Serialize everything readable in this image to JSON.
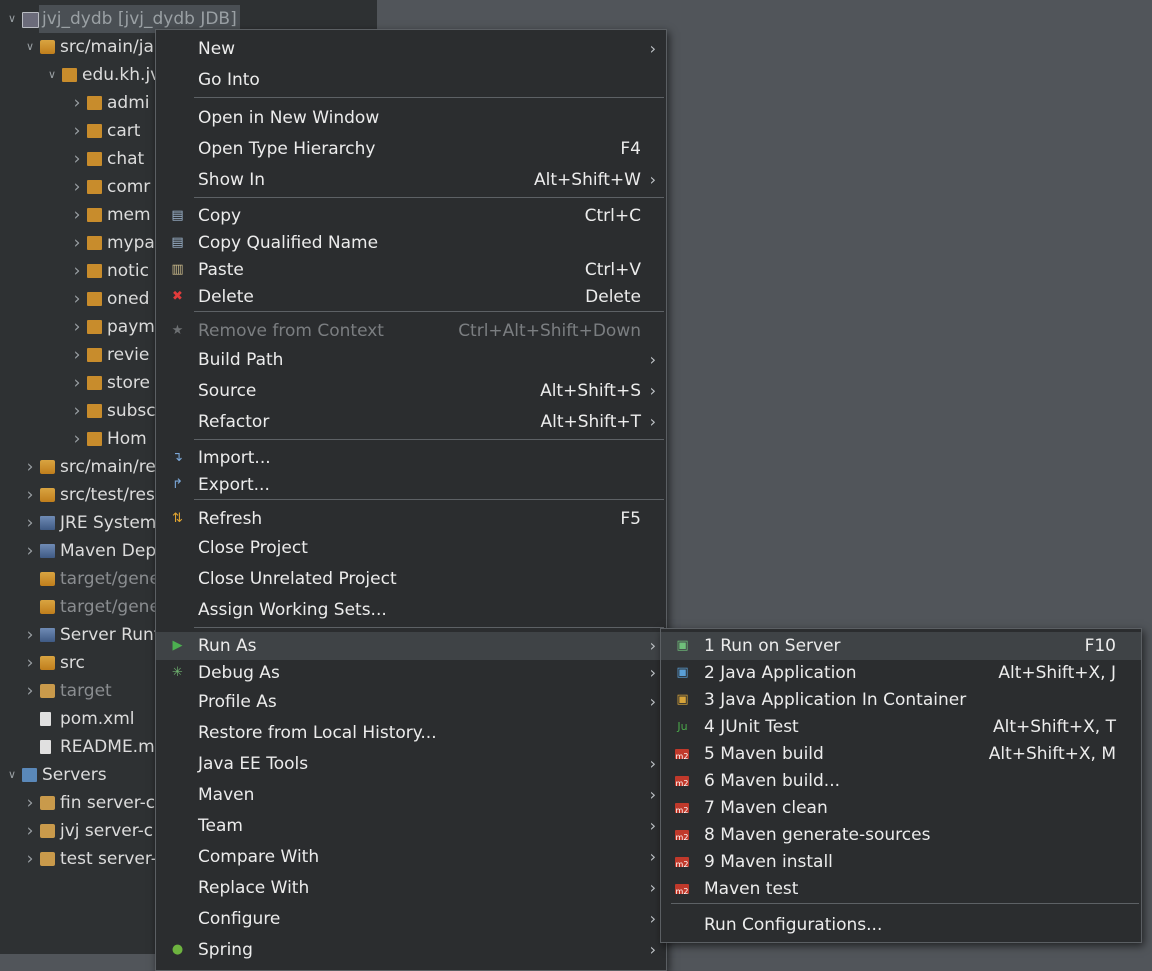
{
  "explorer": {
    "items": [
      {
        "label": "jvj_dydb [jvj_dydb JDB]",
        "indent": 0,
        "chev": "open",
        "icon": "project-icon",
        "selected": true
      },
      {
        "label": "src/main/ja",
        "indent": 1,
        "chev": "open",
        "icon": "package-folder-icon"
      },
      {
        "label": "edu.kh.jv",
        "indent": 2,
        "chev": "open",
        "icon": "package-icon"
      },
      {
        "label": "admi",
        "indent": 3,
        "chev": "closed",
        "icon": "package-icon"
      },
      {
        "label": "cart",
        "indent": 3,
        "chev": "closed",
        "icon": "package-icon"
      },
      {
        "label": "chat",
        "indent": 3,
        "chev": "closed",
        "icon": "package-icon"
      },
      {
        "label": "comr",
        "indent": 3,
        "chev": "closed",
        "icon": "package-icon"
      },
      {
        "label": "mem",
        "indent": 3,
        "chev": "closed",
        "icon": "package-icon"
      },
      {
        "label": "mypa",
        "indent": 3,
        "chev": "closed",
        "icon": "package-icon"
      },
      {
        "label": "notic",
        "indent": 3,
        "chev": "closed",
        "icon": "package-icon"
      },
      {
        "label": "oned",
        "indent": 3,
        "chev": "closed",
        "icon": "package-icon"
      },
      {
        "label": "paym",
        "indent": 3,
        "chev": "closed",
        "icon": "package-icon"
      },
      {
        "label": "revie",
        "indent": 3,
        "chev": "closed",
        "icon": "package-icon"
      },
      {
        "label": "store",
        "indent": 3,
        "chev": "closed",
        "icon": "package-icon"
      },
      {
        "label": "subsc",
        "indent": 3,
        "chev": "closed",
        "icon": "package-icon"
      },
      {
        "label": "Hom",
        "indent": 3,
        "chev": "closed",
        "icon": "package-icon"
      },
      {
        "label": "src/main/re",
        "indent": 1,
        "chev": "closed",
        "icon": "package-folder-icon"
      },
      {
        "label": "src/test/res",
        "indent": 1,
        "chev": "closed",
        "icon": "package-folder-icon"
      },
      {
        "label": "JRE System",
        "indent": 1,
        "chev": "closed",
        "icon": "library-icon"
      },
      {
        "label": "Maven Dep",
        "indent": 1,
        "chev": "closed",
        "icon": "library-icon"
      },
      {
        "label": "target/gene",
        "indent": 1,
        "chev": "none",
        "icon": "package-folder-icon",
        "dim": true
      },
      {
        "label": "target/gene",
        "indent": 1,
        "chev": "none",
        "icon": "package-folder-icon",
        "dim": true
      },
      {
        "label": "Server Runt",
        "indent": 1,
        "chev": "closed",
        "icon": "library-icon"
      },
      {
        "label": "src",
        "indent": 1,
        "chev": "closed",
        "icon": "package-folder-icon"
      },
      {
        "label": "target",
        "indent": 1,
        "chev": "closed",
        "icon": "folder-icon",
        "dim": true
      },
      {
        "label": "pom.xml",
        "indent": 1,
        "chev": "none",
        "icon": "file-icon"
      },
      {
        "label": "README.m",
        "indent": 1,
        "chev": "none",
        "icon": "file-icon"
      },
      {
        "label": "Servers",
        "indent": 0,
        "chev": "open",
        "icon": "servers-icon"
      },
      {
        "label": "fin server-c",
        "indent": 1,
        "chev": "closed",
        "icon": "folder-icon"
      },
      {
        "label": "jvj server-c",
        "indent": 1,
        "chev": "closed",
        "icon": "folder-icon"
      },
      {
        "label": "test server-",
        "indent": 1,
        "chev": "closed",
        "icon": "folder-icon"
      }
    ]
  },
  "context_menu": {
    "items": [
      {
        "label": "New",
        "key": "",
        "submenu": true
      },
      {
        "label": "Go Into",
        "key": ""
      },
      {
        "sep": true
      },
      {
        "label": "Open in New Window",
        "key": ""
      },
      {
        "label": "Open Type Hierarchy",
        "key": "F4"
      },
      {
        "label": "Show In",
        "key": "Alt+Shift+W",
        "submenu": true
      },
      {
        "sep": true
      },
      {
        "label": "Copy",
        "key": "Ctrl+C",
        "icon": "copy-icon"
      },
      {
        "label": "Copy Qualified Name",
        "key": "",
        "icon": "copy-qualified-icon"
      },
      {
        "label": "Paste",
        "key": "Ctrl+V",
        "icon": "paste-icon"
      },
      {
        "label": "Delete",
        "key": "Delete",
        "icon": "delete-icon"
      },
      {
        "sep": true
      },
      {
        "label": "Remove from Context",
        "key": "Ctrl+Alt+Shift+Down",
        "icon": "remove-context-icon",
        "disabled": true
      },
      {
        "label": "Build Path",
        "key": "",
        "submenu": true
      },
      {
        "label": "Source",
        "key": "Alt+Shift+S",
        "submenu": true
      },
      {
        "label": "Refactor",
        "key": "Alt+Shift+T",
        "submenu": true
      },
      {
        "sep": true
      },
      {
        "label": "Import...",
        "key": "",
        "icon": "import-icon"
      },
      {
        "label": "Export...",
        "key": "",
        "icon": "export-icon"
      },
      {
        "sep": true
      },
      {
        "label": "Refresh",
        "key": "F5",
        "icon": "refresh-icon"
      },
      {
        "label": "Close Project",
        "key": ""
      },
      {
        "label": "Close Unrelated Project",
        "key": ""
      },
      {
        "label": "Assign Working Sets...",
        "key": ""
      },
      {
        "sep": true
      },
      {
        "label": "Run As",
        "key": "",
        "submenu": true,
        "icon": "run-icon",
        "highlighted": true
      },
      {
        "label": "Debug As",
        "key": "",
        "submenu": true,
        "icon": "debug-icon"
      },
      {
        "label": "Profile As",
        "key": "",
        "submenu": true
      },
      {
        "label": "Restore from Local History...",
        "key": ""
      },
      {
        "label": "Java EE Tools",
        "key": "",
        "submenu": true
      },
      {
        "label": "Maven",
        "key": "",
        "submenu": true
      },
      {
        "label": "Team",
        "key": "",
        "submenu": true
      },
      {
        "label": "Compare With",
        "key": "",
        "submenu": true
      },
      {
        "label": "Replace With",
        "key": "",
        "submenu": true
      },
      {
        "label": "Configure",
        "key": "",
        "submenu": true
      },
      {
        "label": "Spring",
        "key": "",
        "submenu": true,
        "icon": "spring-icon"
      }
    ]
  },
  "runas_menu": {
    "items": [
      {
        "label": "1 Run on Server",
        "key": "F10",
        "icon": "run-on-server-icon",
        "highlighted": true
      },
      {
        "label": "2 Java Application",
        "key": "Alt+Shift+X, J",
        "icon": "java-app-icon"
      },
      {
        "label": "3 Java Application In Container",
        "key": "",
        "icon": "java-container-icon"
      },
      {
        "label": "4 JUnit Test",
        "key": "Alt+Shift+X, T",
        "icon": "junit-icon"
      },
      {
        "label": "5 Maven build",
        "key": "Alt+Shift+X, M",
        "icon": "maven-icon"
      },
      {
        "label": "6 Maven build...",
        "key": "",
        "icon": "maven-icon"
      },
      {
        "label": "7 Maven clean",
        "key": "",
        "icon": "maven-icon"
      },
      {
        "label": "8 Maven generate-sources",
        "key": "",
        "icon": "maven-icon"
      },
      {
        "label": "9 Maven install",
        "key": "",
        "icon": "maven-icon"
      },
      {
        "label": "Maven test",
        "key": "",
        "icon": "maven-icon"
      },
      {
        "sep": true
      },
      {
        "label": "Run Configurations...",
        "key": ""
      }
    ]
  }
}
